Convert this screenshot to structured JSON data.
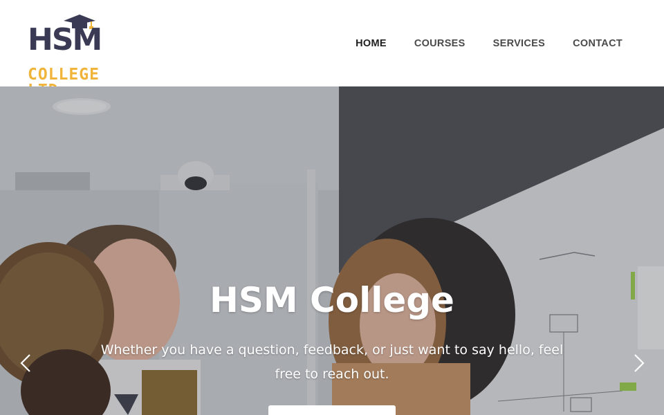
{
  "brand": {
    "logo_main": "HSM",
    "logo_sub": "COLLEGE LTD",
    "colors": {
      "dark": "#3a3a55",
      "accent": "#f0b43a"
    }
  },
  "nav": {
    "items": [
      {
        "label": "HOME",
        "active": true
      },
      {
        "label": "COURSES"
      },
      {
        "label": "SERVICES"
      },
      {
        "label": "CONTACT"
      }
    ]
  },
  "hero": {
    "title": "HSM College",
    "text": "Whether you have a question, feedback, or just want to say hello, feel free to reach out.",
    "button_label": "",
    "prev_icon": "chevron-left-icon",
    "next_icon": "chevron-right-icon"
  }
}
